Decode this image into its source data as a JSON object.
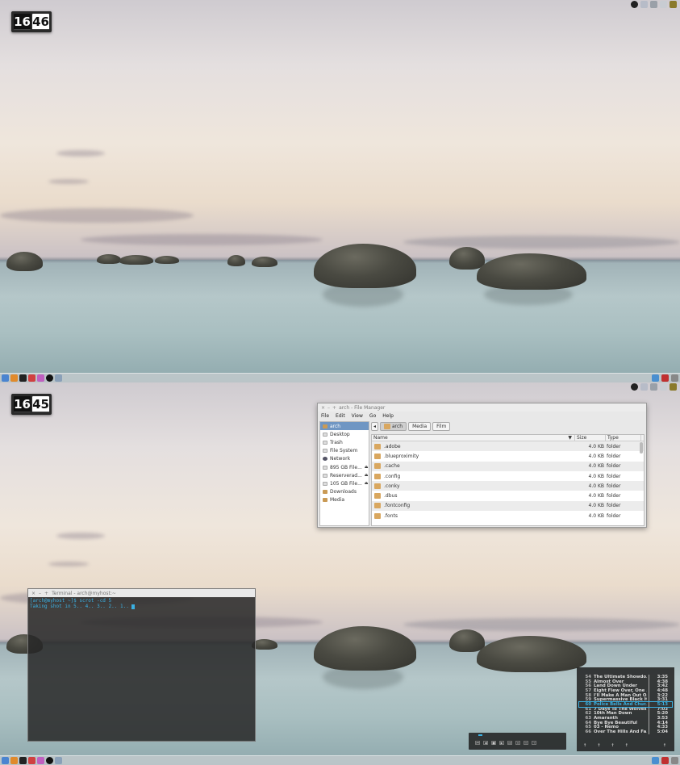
{
  "top_screen": {
    "clock": {
      "hours": "16",
      "minutes": "46"
    },
    "tray_icons": [
      "steam-icon",
      "bluetooth-icon",
      "network-icon",
      "volume-icon",
      "power-icon"
    ],
    "launchers": [
      "finder-icon",
      "firefox-icon",
      "terminal-icon",
      "chrome-icon",
      "skype-icon",
      "steam-icon",
      "screenshot-icon"
    ]
  },
  "bottom_screen": {
    "clock": {
      "hours": "16",
      "minutes": "45"
    },
    "file_manager": {
      "title": "arch - File Manager",
      "menu": [
        "File",
        "Edit",
        "View",
        "Go",
        "Help"
      ],
      "sidebar": [
        {
          "label": "arch",
          "icon": "home-folder-icon",
          "selected": true
        },
        {
          "label": "Desktop",
          "icon": "desktop-icon"
        },
        {
          "label": "Trash",
          "icon": "trash-icon"
        },
        {
          "label": "File System",
          "icon": "filesystem-icon"
        },
        {
          "label": "Network",
          "icon": "network-icon"
        },
        {
          "label": "895 GB File...",
          "icon": "drive-icon",
          "eject": true
        },
        {
          "label": "Reserverad...",
          "icon": "drive-icon",
          "eject": true
        },
        {
          "label": "105 GB File...",
          "icon": "drive-icon",
          "eject": true
        },
        {
          "label": "Downloads",
          "icon": "folder-icon"
        },
        {
          "label": "Media",
          "icon": "folder-icon"
        }
      ],
      "path_buttons": [
        "arch",
        "Media",
        "Film"
      ],
      "columns": {
        "name": "Name",
        "size": "Size",
        "type": "Type"
      },
      "rows": [
        {
          "name": ".adobe",
          "size": "4.0 KB",
          "type": "folder"
        },
        {
          "name": ".blueproximity",
          "size": "4.0 KB",
          "type": "folder"
        },
        {
          "name": ".cache",
          "size": "4.0 KB",
          "type": "folder"
        },
        {
          "name": ".config",
          "size": "4.0 KB",
          "type": "folder"
        },
        {
          "name": ".conky",
          "size": "4.0 KB",
          "type": "folder"
        },
        {
          "name": ".dbus",
          "size": "4.0 KB",
          "type": "folder"
        },
        {
          "name": ".fontconfig",
          "size": "4.0 KB",
          "type": "folder"
        },
        {
          "name": ".fonts",
          "size": "4.0 KB",
          "type": "folder"
        }
      ]
    },
    "terminal": {
      "title": "Terminal - arch@myhost:~",
      "lines": [
        "[arch@myhost ~]$ scrot -cd 5",
        "Taking shot in 5.. 4.. 3.. 2.. 1.. "
      ]
    },
    "playlist": {
      "tracks": [
        {
          "n": "54",
          "title": "The Ultimate Showdo...",
          "dur": "3:35"
        },
        {
          "n": "55",
          "title": "Almost Over",
          "dur": "4:38"
        },
        {
          "n": "56",
          "title": "Land Down Under",
          "dur": "3:42"
        },
        {
          "n": "57",
          "title": "Eight Flew Over, One ...",
          "dur": "4:48"
        },
        {
          "n": "58",
          "title": "I'll Make A Man Out O...",
          "dur": "3:22"
        },
        {
          "n": "59",
          "title": "Supermassive Black H...",
          "dur": "3:31"
        },
        {
          "n": "60",
          "title": "Police Bells And Chur...",
          "dur": "5:13",
          "current": true
        },
        {
          "n": "61",
          "title": "7 Days To The Wolves",
          "dur": "7:03"
        },
        {
          "n": "62",
          "title": "10th Man Down",
          "dur": "5:20"
        },
        {
          "n": "63",
          "title": "Amaranth",
          "dur": "3:53"
        },
        {
          "n": "64",
          "title": "Bye Bye Beautiful",
          "dur": "4:14"
        },
        {
          "n": "65",
          "title": "03 - Nemo",
          "dur": "4:33"
        },
        {
          "n": "66",
          "title": "Over The Hills And Fa...",
          "dur": "5:04"
        }
      ],
      "controls": [
        "↑",
        "↑",
        "↑",
        "↑",
        "↑"
      ]
    },
    "player": {
      "buttons": [
        "⏮",
        "◀",
        "■",
        "▶",
        "⏭",
        "≡",
        "↔",
        "→"
      ]
    }
  },
  "colors": {
    "accent": "#3ab0e2",
    "selection": "#6f96c3",
    "folder": "#d9a75f"
  }
}
